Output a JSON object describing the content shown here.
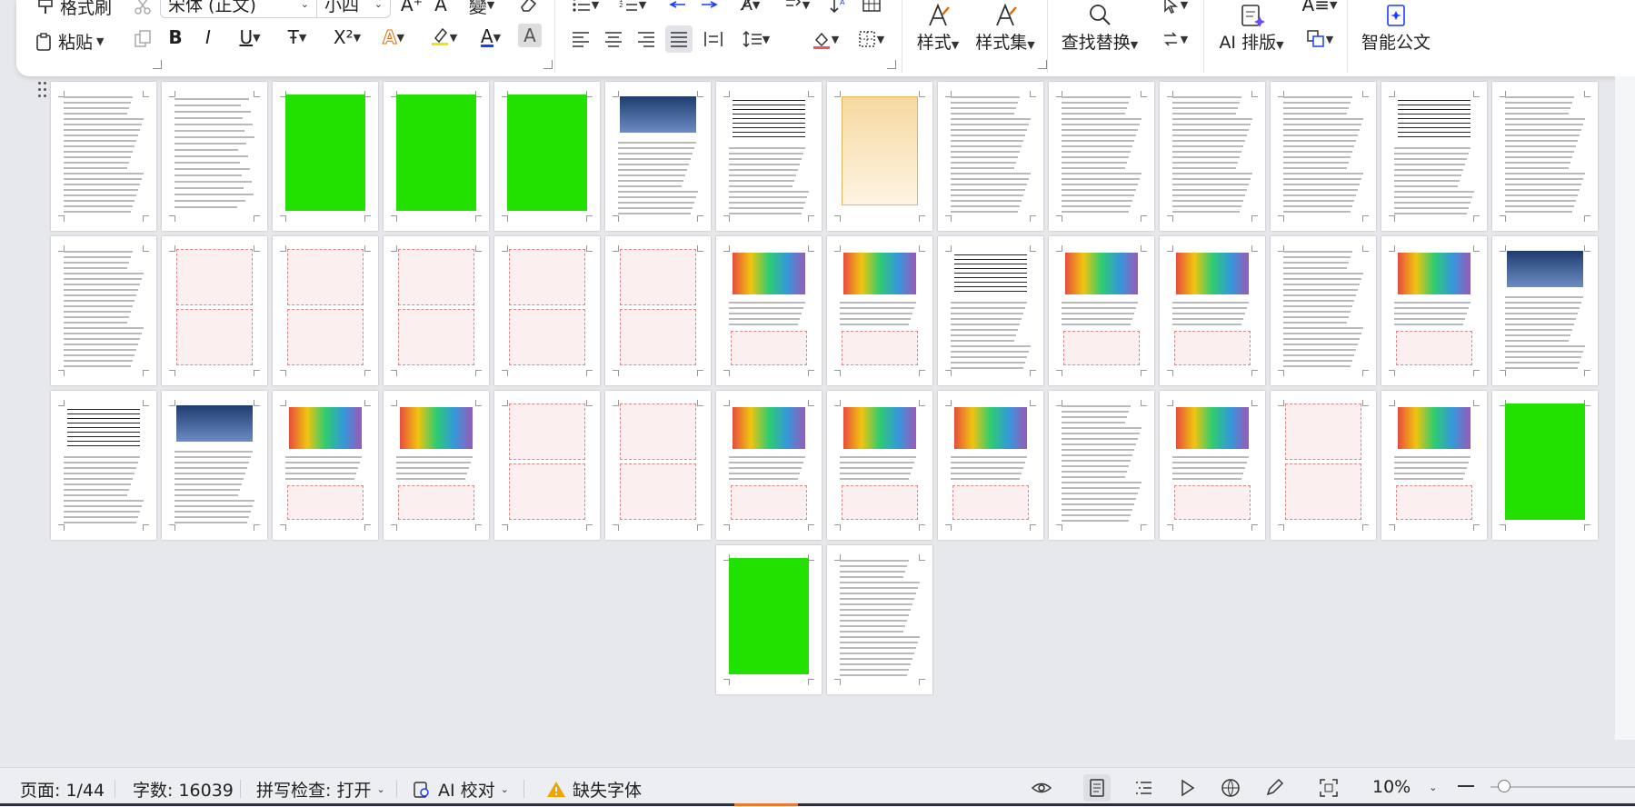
{
  "ribbon": {
    "format_painter": "格式刷",
    "paste": "粘贴",
    "font_name": "宋体 (正文)",
    "font_size": "小四",
    "styles": "样式",
    "style_sets": "样式集",
    "find_replace": "查找替换",
    "ai_layout": "AI 排版",
    "smart_doc": "智能公文",
    "bold": "B",
    "italic": "I",
    "underline": "U",
    "strikethrough": "Ŧ",
    "superscript": "X²",
    "font_increase": "A⁺",
    "font_decrease": "A",
    "phonetic": "變",
    "text_char_border": "A"
  },
  "status": {
    "page": "页面: 1/44",
    "word_count": "字数: 16039",
    "spell_check": "拼写检查: 打开",
    "ai_proofread": "AI 校对",
    "missing_font": "缺失字体",
    "zoom": "10%"
  },
  "colors": {
    "highlight": "#f5e400",
    "font_color": "#1a3cff",
    "highlight_green": "#22e000",
    "warning": "#f0a400"
  },
  "icons": [
    "format-painter-icon",
    "paste-icon",
    "bold-icon",
    "italic-icon",
    "underline-icon",
    "eye-icon",
    "page-view-icon",
    "outline-view-icon",
    "play-icon",
    "web-view-icon",
    "pen-icon",
    "fit-window-icon",
    "zoom-out-icon"
  ]
}
